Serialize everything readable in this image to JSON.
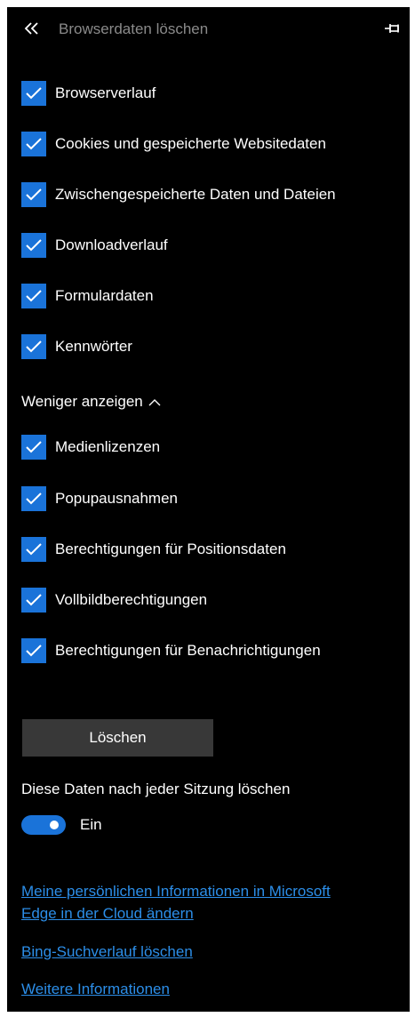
{
  "header": {
    "back_icon": "double-chevron-left-icon",
    "title": "Browserdaten löschen",
    "pin_icon": "pin-icon"
  },
  "checkboxes_primary": [
    {
      "label": "Browserverlauf",
      "checked": true
    },
    {
      "label": "Cookies und gespeicherte Websitedaten",
      "checked": true
    },
    {
      "label": "Zwischengespeicherte Daten und Dateien",
      "checked": true
    },
    {
      "label": "Downloadverlauf",
      "checked": true
    },
    {
      "label": "Formulardaten",
      "checked": true
    },
    {
      "label": "Kennwörter",
      "checked": true
    }
  ],
  "show_less": {
    "label": "Weniger anzeigen",
    "icon": "chevron-up-icon"
  },
  "checkboxes_secondary": [
    {
      "label": "Medienlizenzen",
      "checked": true
    },
    {
      "label": "Popupausnahmen",
      "checked": true
    },
    {
      "label": "Berechtigungen für Positionsdaten",
      "checked": true
    },
    {
      "label": "Vollbildberechtigungen",
      "checked": true
    },
    {
      "label": "Berechtigungen für Benachrichtigungen",
      "checked": true
    }
  ],
  "clear_button": "Löschen",
  "session": {
    "label": "Diese Daten nach jeder Sitzung löschen",
    "toggle_state": "Ein",
    "toggle_on": true
  },
  "links": {
    "cloud_info_line1": "Meine persönlichen Informationen in Microsoft",
    "cloud_info_line2": "Edge in der Cloud ändern",
    "bing_history": "Bing-Suchverlauf löschen",
    "more_info": "Weitere Informationen"
  },
  "colors": {
    "background": "#000000",
    "accent": "#1a73d9",
    "link": "#2c8ee8",
    "button": "#383838",
    "title_muted": "#8a8a8a"
  }
}
